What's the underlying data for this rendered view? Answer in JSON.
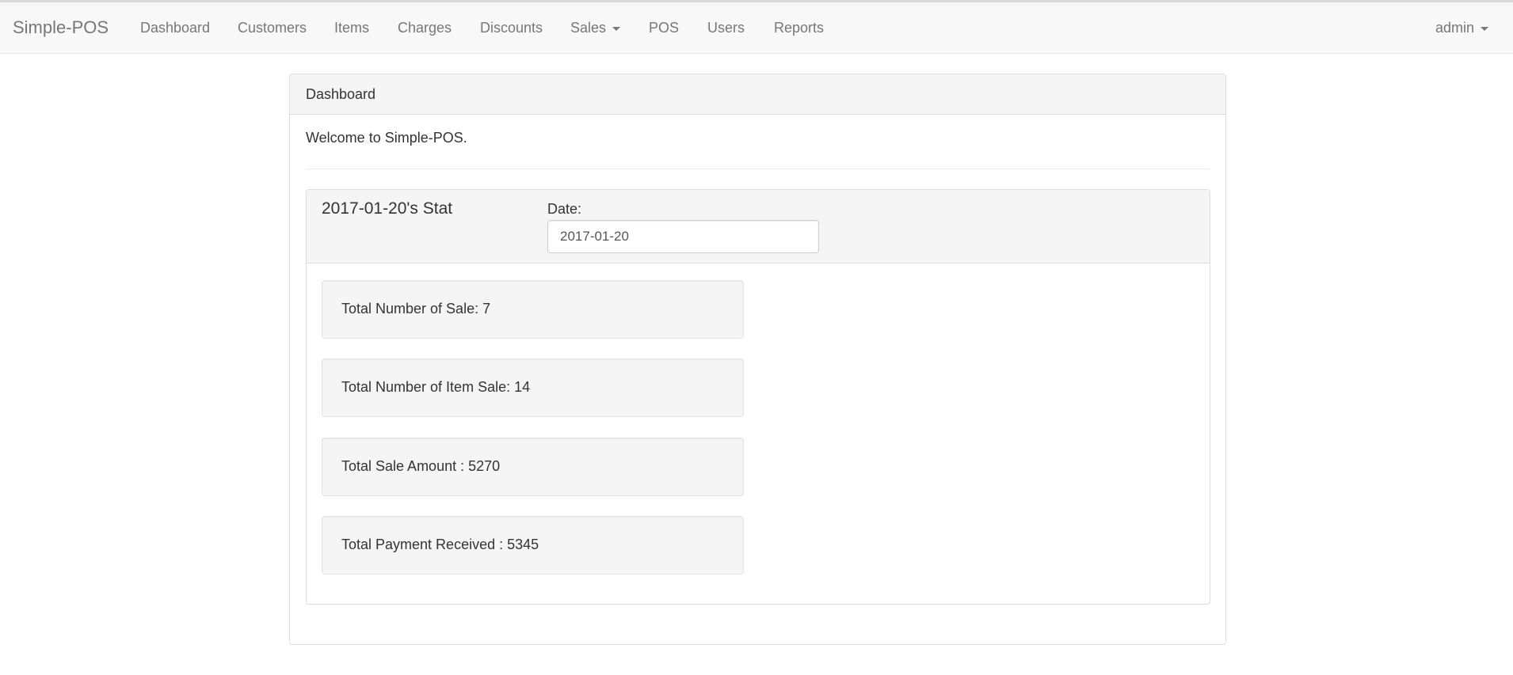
{
  "navbar": {
    "brand": "Simple-POS",
    "items": [
      {
        "label": "Dashboard"
      },
      {
        "label": "Customers"
      },
      {
        "label": "Items"
      },
      {
        "label": "Charges"
      },
      {
        "label": "Discounts"
      },
      {
        "label": "Sales"
      },
      {
        "label": "POS"
      },
      {
        "label": "Users"
      },
      {
        "label": "Reports"
      }
    ],
    "user": "admin"
  },
  "dashboard": {
    "heading": "Dashboard",
    "welcome": "Welcome to Simple-POS.",
    "stat": {
      "title": "2017-01-20's Stat",
      "date_label": "Date:",
      "date_value": "2017-01-20",
      "items": [
        {
          "text": "Total Number of Sale: 7"
        },
        {
          "text": "Total Number of Item Sale: 14"
        },
        {
          "text": "Total Sale Amount : 5270"
        },
        {
          "text": "Total Payment Received : 5345"
        }
      ]
    }
  }
}
